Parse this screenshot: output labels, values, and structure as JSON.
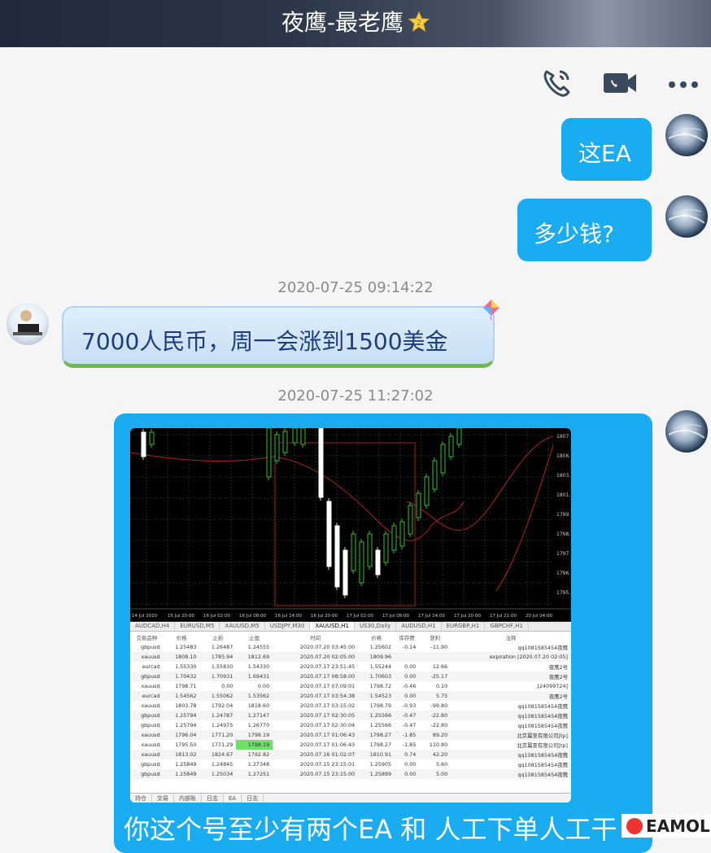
{
  "header": {
    "title": "夜鹰-最老鹰",
    "star_badge": "2"
  },
  "actions": {
    "call_icon": "phone-icon",
    "video_icon": "video-icon",
    "more_icon": "more-icon"
  },
  "messages": {
    "out1": "这EA",
    "out2": "多少钱?",
    "ts1": "2020-07-25 09:14:22",
    "in1": "7000人民币，周一会涨到1500美金",
    "ts2": "2020-07-25 11:27:02",
    "bottom": "你这个号至少有两个EA  和 人工下单人工干"
  },
  "screenshot": {
    "date_axis": [
      "14 Jul 2020",
      "15 Jul 20:00",
      "16 Jul 02:00",
      "16 Jul 08:00",
      "16 Jul 14:00",
      "16 Jul 20:00",
      "17 Jul 02:00",
      "17 Jul 08:00",
      "17 Jul 14:00",
      "17 Jul 20:00",
      "17 Jul 21:00",
      "20 Jul 04:00"
    ],
    "price_axis": [
      "1807.",
      "1806.",
      "1803.",
      "1801.",
      "1799.",
      "1798.",
      "1797.",
      "1796.",
      "1795."
    ],
    "tabs": [
      "AUDCAD,H4",
      "EURUSD,M5",
      "XAUUSD,M5",
      "USDJPY,M30",
      "XAUUSD,H1",
      "US30,Daily",
      "AUDUSD,H1",
      "EURGBP,H1",
      "GBPCHF,H1"
    ],
    "active_tab": 4,
    "columns": [
      "交易品种",
      "价格",
      "止损",
      "止盈",
      "时间",
      "价格",
      "库存费",
      "获利",
      "注释"
    ],
    "rows": [
      [
        "gbpusd",
        "1.25483",
        "1.26487",
        "1.24555",
        "2020.07.20 03:45:00",
        "1.25602",
        "-0.14",
        "-11.90",
        "qq1081585454夜鹰"
      ],
      [
        "xauusd",
        "1808.10",
        "1785.94",
        "1812.69",
        "2020.07.20 02:05:00",
        "1809.96",
        "",
        "",
        "expiration [2020.07.20 02:05]"
      ],
      [
        "eurcad",
        "1.55330",
        "1.55830",
        "1.54330",
        "2020.07.17 23:51:45",
        "1.55244",
        "0.00",
        "12.66",
        "夜鹰2号"
      ],
      [
        "gbpusd",
        "1.70432",
        "1.70931",
        "1.69431",
        "2020.07.17 08:58:00",
        "1.70603",
        "0.00",
        "-25.17",
        "夜鹰2号"
      ],
      [
        "xauusd",
        "1798.71",
        "0.00",
        "0.00",
        "2020.07.17 07:09:01",
        "1798.72",
        "-0.46",
        "0.10",
        "[24099724]"
      ],
      [
        "eurcad",
        "1.54562",
        "1.55062",
        "1.53562",
        "2020.07.17 03:54:38",
        "1.54523",
        "0.00",
        "5.75",
        "夜鹰2号"
      ],
      [
        "xauusd",
        "1803.78",
        "1792.04",
        "1818.60",
        "2020.07.17 03:15:02",
        "1798.79",
        "-0.93",
        "-99.80",
        "qq1081585454夜鹰"
      ],
      [
        "gbpusd",
        "1.25794",
        "1.24787",
        "1.27147",
        "2020.07.17 02:30:05",
        "1.25566",
        "-0.47",
        "-22.80",
        "qq1081585454夜鹰"
      ],
      [
        "gbpusd",
        "1.25794",
        "1.24975",
        "1.26770",
        "2020.07.17 02:30:04",
        "1.25566",
        "-0.47",
        "-22.80",
        "qq1081585454夜鹰"
      ],
      [
        "xauusd",
        "1796.04",
        "1771.20",
        "1798.19",
        "2020.07.17 01:06:43",
        "1798.27",
        "-1.85",
        "89.20",
        "北京翼至有限公司[tp]"
      ],
      [
        "xauusd",
        "1795.50",
        "1771.29",
        "1798.19",
        "2020.07.17 01:06:43",
        "1798.27",
        "-1.85",
        "110.80",
        "北京翼至有限公司[tp]"
      ],
      [
        "xauusd",
        "1813.02",
        "1824.67",
        "1792.82",
        "2020.07.16 01:02:07",
        "1810.91",
        "0.74",
        "42.20",
        "qq1081585454夜鹰"
      ],
      [
        "gbpusd",
        "1.25849",
        "1.24845",
        "1.27348",
        "2020.07.15 23:15:01",
        "1.25905",
        "0.00",
        "5.60",
        "qq1081585454夜鹰"
      ],
      [
        "gbpusd",
        "1.25849",
        "1.25034",
        "1.27251",
        "2020.07.15 23:15:00",
        "1.25899",
        "0.00",
        "5.00",
        "qq1081585454夜鹰"
      ]
    ],
    "bottom_tabs": [
      "持仓",
      "交易",
      "内部账",
      "日志",
      "EA",
      "日志"
    ]
  },
  "watermark": "EAMOL"
}
